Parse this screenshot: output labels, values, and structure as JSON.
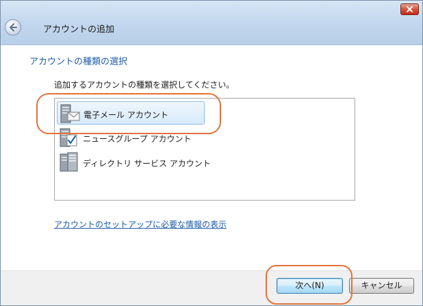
{
  "window": {
    "title": "アカウントの追加"
  },
  "page": {
    "heading": "アカウントの種類の選択",
    "instruction": "追加するアカウントの種類を選択してください。",
    "list": {
      "items": [
        {
          "label": "電子メール アカウント",
          "icon": "email-account-icon",
          "selected": true
        },
        {
          "label": "ニュースグループ アカウント",
          "icon": "newsgroup-account-icon",
          "selected": false
        },
        {
          "label": "ディレクトリ サービス アカウント",
          "icon": "directory-service-icon",
          "selected": false
        }
      ]
    },
    "info_link": "アカウントのセットアップに必要な情報の表示"
  },
  "footer": {
    "next_label": "次へ(N)",
    "cancel_label": "キャンセル"
  },
  "colors": {
    "heading": "#1e5aa6",
    "link": "#1e5aa6",
    "annotation": "#e2723a",
    "selection": "#d8ebfb"
  }
}
